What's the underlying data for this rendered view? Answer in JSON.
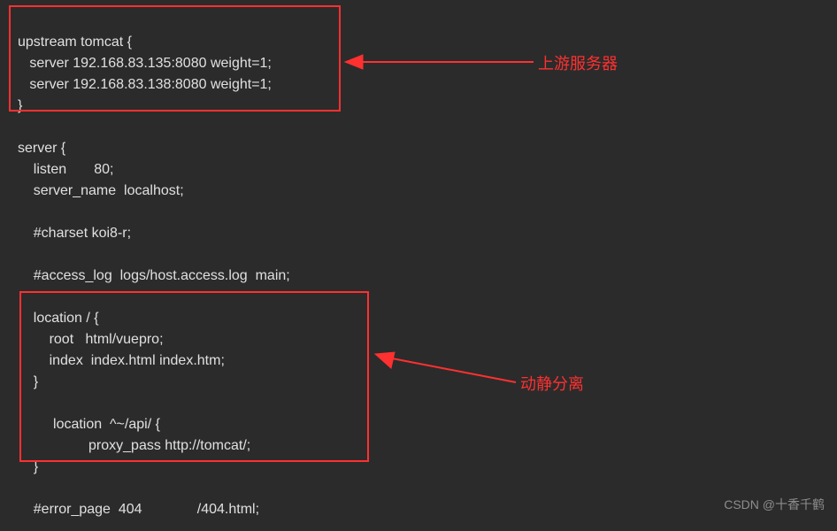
{
  "code": {
    "line1": "upstream tomcat {",
    "line2": "   server 192.168.83.135:8080 weight=1;",
    "line3": "   server 192.168.83.138:8080 weight=1;",
    "line4": "}",
    "line5": "",
    "line6": "server {",
    "line7": "    listen       80;",
    "line8": "    server_name  localhost;",
    "line9": "",
    "line10": "    #charset koi8-r;",
    "line11": "",
    "line12": "    #access_log  logs/host.access.log  main;",
    "line13": "",
    "line14": "    location / {",
    "line15": "        root   html/vuepro;",
    "line16": "        index  index.html index.htm;",
    "line17": "    }",
    "line18": "",
    "line19": "         location  ^~/api/ {",
    "line20": "                  proxy_pass http://tomcat/;",
    "line21": "    }",
    "line22": "",
    "line23": "    #error_page  404              /404.html;"
  },
  "annotations": {
    "upstream_label": "上游服务器",
    "location_label": "动静分离"
  },
  "watermark": "CSDN @十香千鹤"
}
